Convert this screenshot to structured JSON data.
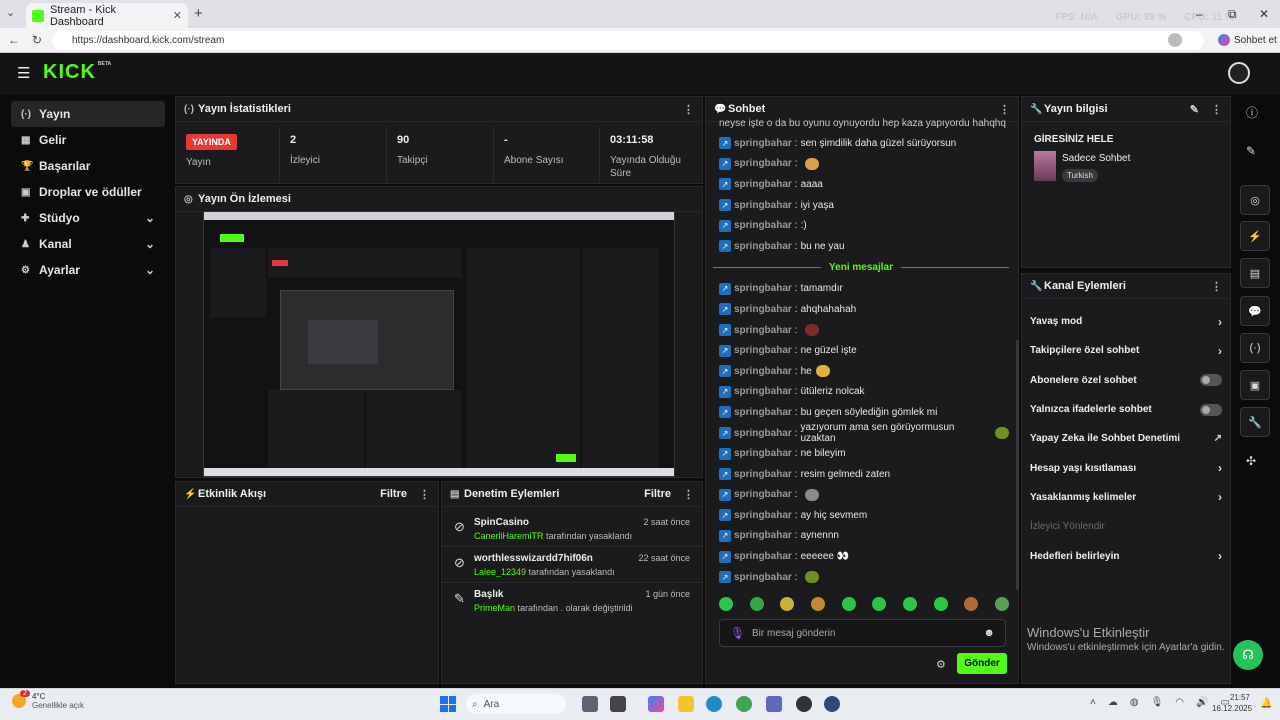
{
  "browser": {
    "tab_title": "Stream - Kick Dashboard",
    "new_tab": "+",
    "url": "https://dashboard.kick.com/stream",
    "right_label": "Sohbet et",
    "overlay_text": [
      "FPS: N/A",
      "GPU: 39 %",
      "CPU: 11 %"
    ],
    "win_min": "–",
    "win_max": "⧉",
    "win_close": "✕"
  },
  "app": {
    "logo": "KICK",
    "logo_tag": "BETA"
  },
  "sidebar": {
    "items": [
      {
        "label": "Yayın",
        "icon": "(·)"
      },
      {
        "label": "Gelir",
        "icon": "▦"
      },
      {
        "label": "Başarılar",
        "icon": "🏆"
      },
      {
        "label": "Droplar ve ödüller",
        "icon": "▣"
      },
      {
        "label": "Stüdyo",
        "icon": "✚",
        "chevron": "⌄"
      },
      {
        "label": "Kanal",
        "icon": "♟",
        "chevron": "⌄"
      },
      {
        "label": "Ayarlar",
        "icon": "⚙",
        "chevron": "⌄"
      }
    ]
  },
  "stats": {
    "title": "Yayın İstatistikleri",
    "live_badge": "YAYINDA",
    "items": [
      {
        "value": "",
        "label": "Yayın"
      },
      {
        "value": "2",
        "label": "İzleyici"
      },
      {
        "value": "90",
        "label": "Takipçi"
      },
      {
        "value": "-",
        "label": "Abone Sayısı"
      },
      {
        "value": "03:11:58",
        "label": "Yayında Olduğu Süre"
      }
    ]
  },
  "preview": {
    "title": "Yayın Ön İzlemesi"
  },
  "activity": {
    "title": "Etkinlik Akışı",
    "filter": "Filtre"
  },
  "moderation": {
    "title": "Denetim Eylemleri",
    "filter": "Filtre",
    "rows": [
      {
        "name": "SpinCasino",
        "by": "CanerliHaremiTR",
        "action": "tarafından yasaklandı",
        "time": "2 saat önce",
        "icon": "⊘"
      },
      {
        "name": "worthlesswizardd7hif06n",
        "by": "Lalee_12349",
        "action": "tarafından yasaklandı",
        "time": "22 saat önce",
        "icon": "⊘"
      },
      {
        "name": "Başlık",
        "by": "PrimeMan",
        "action": "tarafından . olarak değiştirildi",
        "time": "1 gün önce",
        "icon": "✎"
      }
    ]
  },
  "chat": {
    "title": "Sohbet",
    "top_line": "neyse işte o da bu oyunu oynuyordu hep kaza yapıyordu hahqhq",
    "new_messages": "Yeni mesajlar",
    "messages": [
      {
        "user": "springbahar",
        "text": "sen şimdilik daha güzel sürüyorsun",
        "emote": ""
      },
      {
        "user": "springbahar",
        "text": "",
        "emote": "#d9a441"
      },
      {
        "user": "springbahar",
        "text": "aaaa",
        "emote": ""
      },
      {
        "user": "springbahar",
        "text": "iyi yaşa",
        "emote": ""
      },
      {
        "user": "springbahar",
        "text": ":)",
        "emote": ""
      },
      {
        "user": "springbahar",
        "text": "bu ne yau",
        "emote": ""
      },
      {
        "user": "springbahar",
        "text": "tamamdır",
        "emote": ""
      },
      {
        "user": "springbahar",
        "text": "ahqhahahah",
        "emote": ""
      },
      {
        "user": "springbahar",
        "text": "",
        "emote": "#7a2b2b"
      },
      {
        "user": "springbahar",
        "text": "ne güzel işte",
        "emote": ""
      },
      {
        "user": "springbahar",
        "text": "he",
        "emote": "#e0b040"
      },
      {
        "user": "springbahar",
        "text": "ütüleriz nolcak",
        "emote": ""
      },
      {
        "user": "springbahar",
        "text": "bu geçen söylediğin gömlek mi",
        "emote": ""
      },
      {
        "user": "springbahar",
        "text": "yazıyorum ama sen görüyormusun uzaktan",
        "emote": "#6f8f2a"
      },
      {
        "user": "springbahar",
        "text": "ne bileyim",
        "emote": ""
      },
      {
        "user": "springbahar",
        "text": "resim gelmedi zaten",
        "emote": ""
      },
      {
        "user": "springbahar",
        "text": "",
        "emote": "#8a8a8a"
      },
      {
        "user": "springbahar",
        "text": "ay hiç sevmem",
        "emote": ""
      },
      {
        "user": "springbahar",
        "text": "aynennn",
        "emote": ""
      },
      {
        "user": "springbahar",
        "text": "eeeeee 👀",
        "emote": ""
      },
      {
        "user": "springbahar",
        "text": "",
        "emote": "#6f8f2a"
      }
    ],
    "emote_bar": [
      "#2ec44a",
      "#33a64a",
      "#c9b23a",
      "#c08a35",
      "#2ec44a",
      "#2ec44a",
      "#2ec44a",
      "#2ec44a",
      "#b06a3a",
      "#5a9e5a"
    ],
    "placeholder": "Bir mesaj gönderin",
    "send": "Gönder"
  },
  "stream_info": {
    "title": "Yayın bilgisi",
    "stream_title": "GİRESİNİZ HELE",
    "category": "Sadece Sohbet",
    "language": "Turkish"
  },
  "channel_actions": {
    "title": "Kanal Eylemleri",
    "items": [
      {
        "label": "Yavaş mod",
        "control": "chevron"
      },
      {
        "label": "Takipçilere özel sohbet",
        "control": "chevron"
      },
      {
        "label": "Abonelere özel sohbet",
        "control": "toggle"
      },
      {
        "label": "Yalnızca ifadelerle sohbet",
        "control": "toggle"
      },
      {
        "label": "Yapay Zeka ile Sohbet Denetimi",
        "control": "external"
      },
      {
        "label": "Hesap yaşı kısıtlaması",
        "control": "chevron"
      },
      {
        "label": "Yasaklanmış kelimeler",
        "control": "chevron"
      },
      {
        "label": "İzleyici Yönlendir",
        "control": "none"
      },
      {
        "label": "Hedefleri belirleyin",
        "control": "chevron"
      }
    ]
  },
  "watermark": {
    "line1": "Windows'u Etkinleştir",
    "line2": "Windows'u etkinleştirmek için Ayarlar'a gidin."
  },
  "taskbar": {
    "weather_temp": "4°C",
    "weather_desc": "Genellikle açık",
    "weather_badge": "2",
    "search": "Ara",
    "time": "21:57",
    "date": "16.12.2025"
  },
  "colors": {
    "accent": "#53fc18",
    "live": "#e53935",
    "panel": "#1b1b1d"
  }
}
